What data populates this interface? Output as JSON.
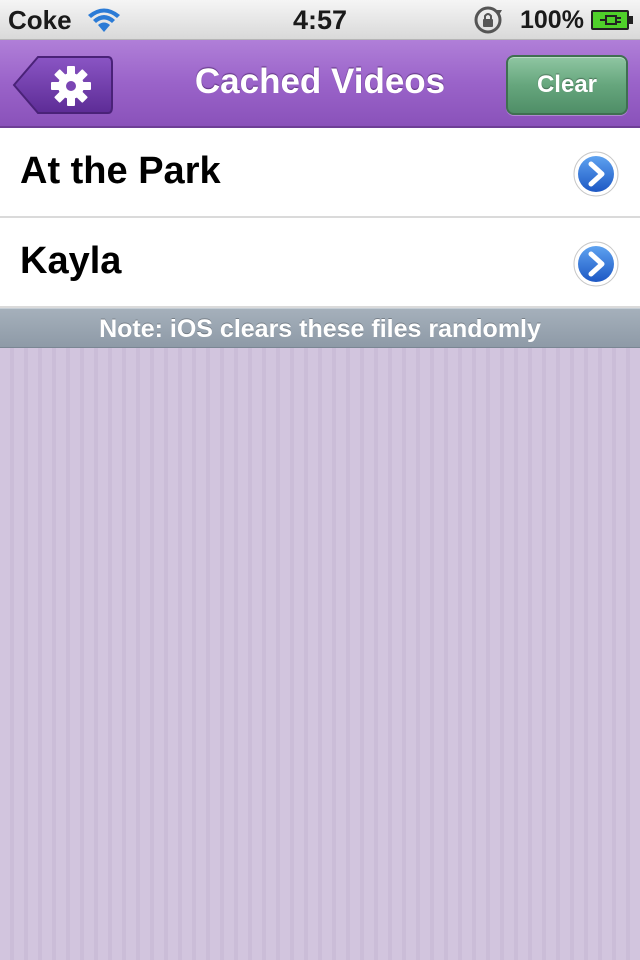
{
  "status_bar": {
    "carrier": "Coke",
    "time": "4:57",
    "battery_percent": "100%",
    "icons": [
      "wifi-icon",
      "rotation-lock-icon",
      "battery-charging-icon"
    ]
  },
  "nav": {
    "title": "Cached Videos",
    "back_icon": "gear-icon",
    "clear_label": "Clear"
  },
  "videos": [
    {
      "title": "At the Park"
    },
    {
      "title": "Kayla"
    }
  ],
  "note": "Note: iOS clears these files randomly",
  "colors": {
    "nav_purple": "#9a63c9",
    "clear_green": "#66a67d",
    "background_lavender": "#d0c3dc",
    "disclosure_blue": "#2a6fd6"
  }
}
